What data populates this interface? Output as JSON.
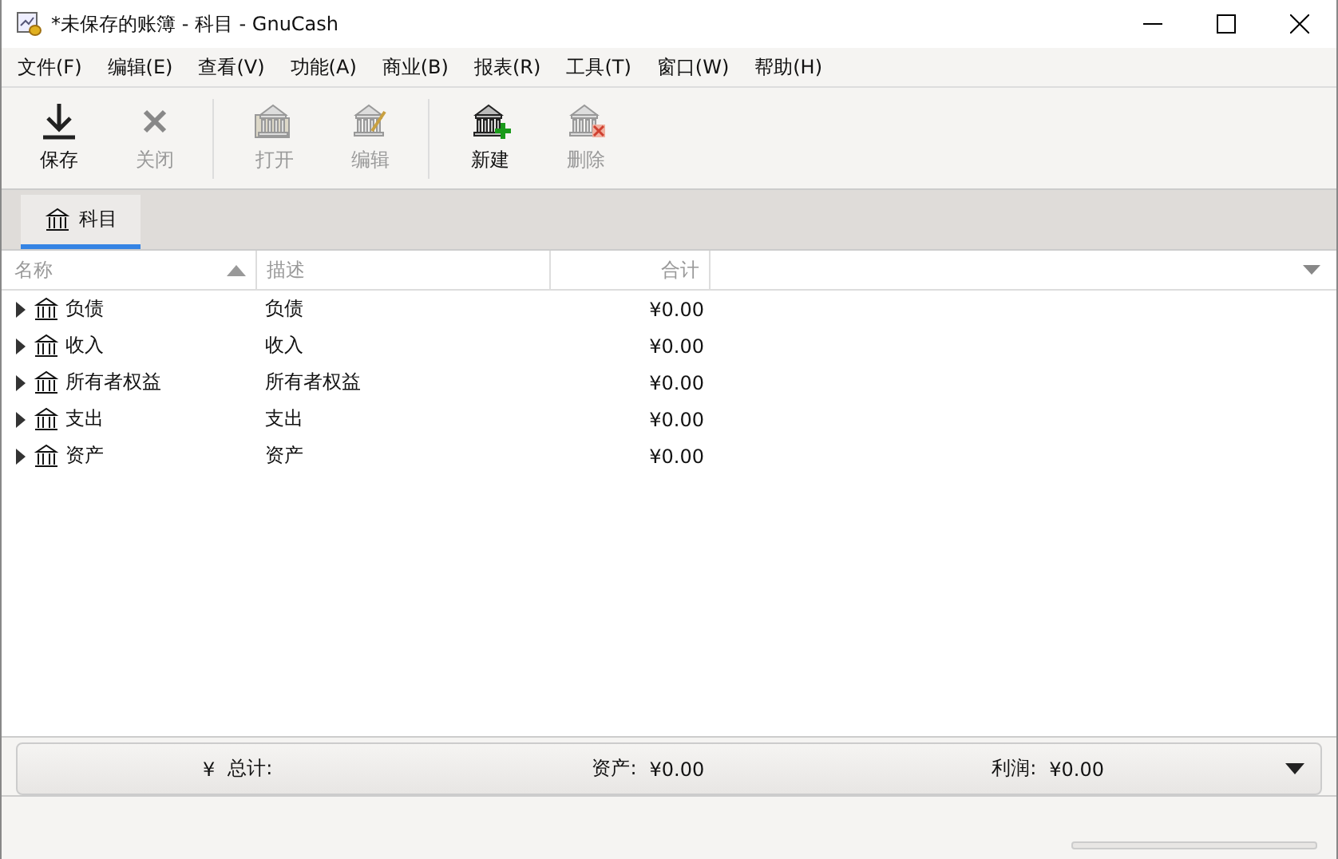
{
  "window": {
    "title": "*未保存的账簿 - 科目 - GnuCash"
  },
  "menu": [
    "文件(F)",
    "编辑(E)",
    "查看(V)",
    "功能(A)",
    "商业(B)",
    "报表(R)",
    "工具(T)",
    "窗口(W)",
    "帮助(H)"
  ],
  "toolbar": [
    {
      "buttons": [
        {
          "kind": "save",
          "label": "保存",
          "disabled": false
        },
        {
          "kind": "close",
          "label": "关闭",
          "disabled": true
        }
      ]
    },
    {
      "buttons": [
        {
          "kind": "open",
          "label": "打开",
          "disabled": true
        },
        {
          "kind": "edit",
          "label": "编辑",
          "disabled": true
        }
      ]
    },
    {
      "buttons": [
        {
          "kind": "new",
          "label": "新建",
          "disabled": false
        },
        {
          "kind": "delete",
          "label": "删除",
          "disabled": true
        }
      ]
    }
  ],
  "tabs": [
    {
      "label": "科目",
      "selected": true
    }
  ],
  "table": {
    "columns": [
      {
        "label": "名称",
        "sorted": true
      },
      {
        "label": "描述",
        "sorted": false
      },
      {
        "label": "合计",
        "sorted": false
      }
    ],
    "rows": [
      {
        "name": "负债",
        "description": "负债",
        "total": "¥0.00",
        "expanded": false
      },
      {
        "name": "收入",
        "description": "收入",
        "total": "¥0.00",
        "expanded": false
      },
      {
        "name": "所有者权益",
        "description": "所有者权益",
        "total": "¥0.00",
        "expanded": false
      },
      {
        "name": "支出",
        "description": "支出",
        "total": "¥0.00",
        "expanded": false
      },
      {
        "name": "资产",
        "description": "资产",
        "total": "¥0.00",
        "expanded": false
      }
    ]
  },
  "status_bar": {
    "progress": {
      "level": 0
    }
  },
  "summary": {
    "currency": "¥",
    "label": "总计:",
    "assets_label": "资产:",
    "assets": "¥0.00",
    "profit_label": "利润:",
    "profit": "¥0.00"
  }
}
